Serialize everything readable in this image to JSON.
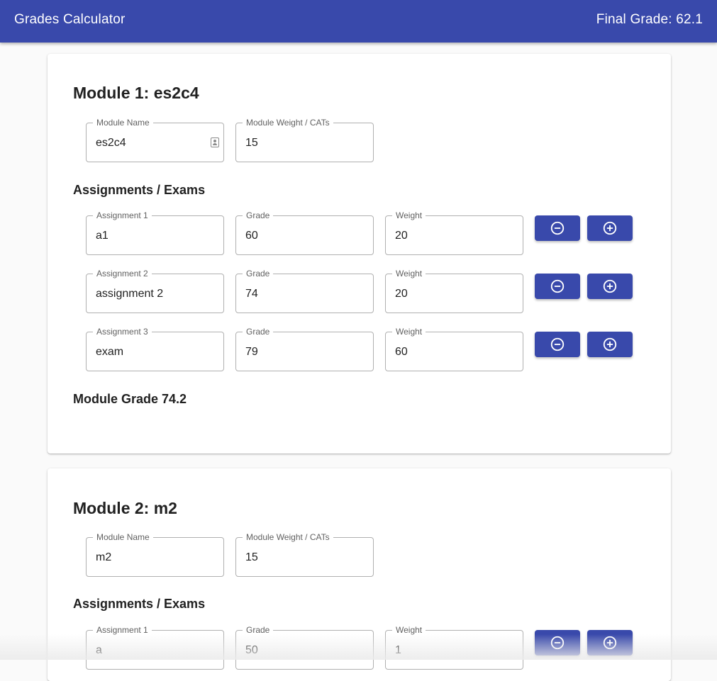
{
  "app": {
    "title": "Grades Calculator",
    "final_grade_text": "Final Grade: 62.1",
    "accent_color": "#3949ab"
  },
  "icons": {
    "remove": "remove-circle-outline-icon",
    "add": "add-circle-outline-icon",
    "contact": "contact-card-icon"
  },
  "modules": [
    {
      "title": "Module 1: es2c4",
      "name_label": "Module Name",
      "name_value": "es2c4",
      "weight_label": "Module Weight / CATs",
      "weight_value": "15",
      "section_title": "Assignments / Exams",
      "assignments": [
        {
          "label": "Assignment 1",
          "name": "a1",
          "grade_label": "Grade",
          "grade": "60",
          "weight_label": "Weight",
          "weight": "20"
        },
        {
          "label": "Assignment 2",
          "name": "assignment 2",
          "grade_label": "Grade",
          "grade": "74",
          "weight_label": "Weight",
          "weight": "20"
        },
        {
          "label": "Assignment 3",
          "name": "exam",
          "grade_label": "Grade",
          "grade": "79",
          "weight_label": "Weight",
          "weight": "60"
        }
      ],
      "module_grade_text": "Module Grade 74.2"
    },
    {
      "title": "Module 2: m2",
      "name_label": "Module Name",
      "name_value": "m2",
      "weight_label": "Module Weight / CATs",
      "weight_value": "15",
      "section_title": "Assignments / Exams",
      "assignments": [
        {
          "label": "Assignment 1",
          "name": "a",
          "grade_label": "Grade",
          "grade": "50",
          "weight_label": "Weight",
          "weight": "1"
        }
      ]
    }
  ]
}
